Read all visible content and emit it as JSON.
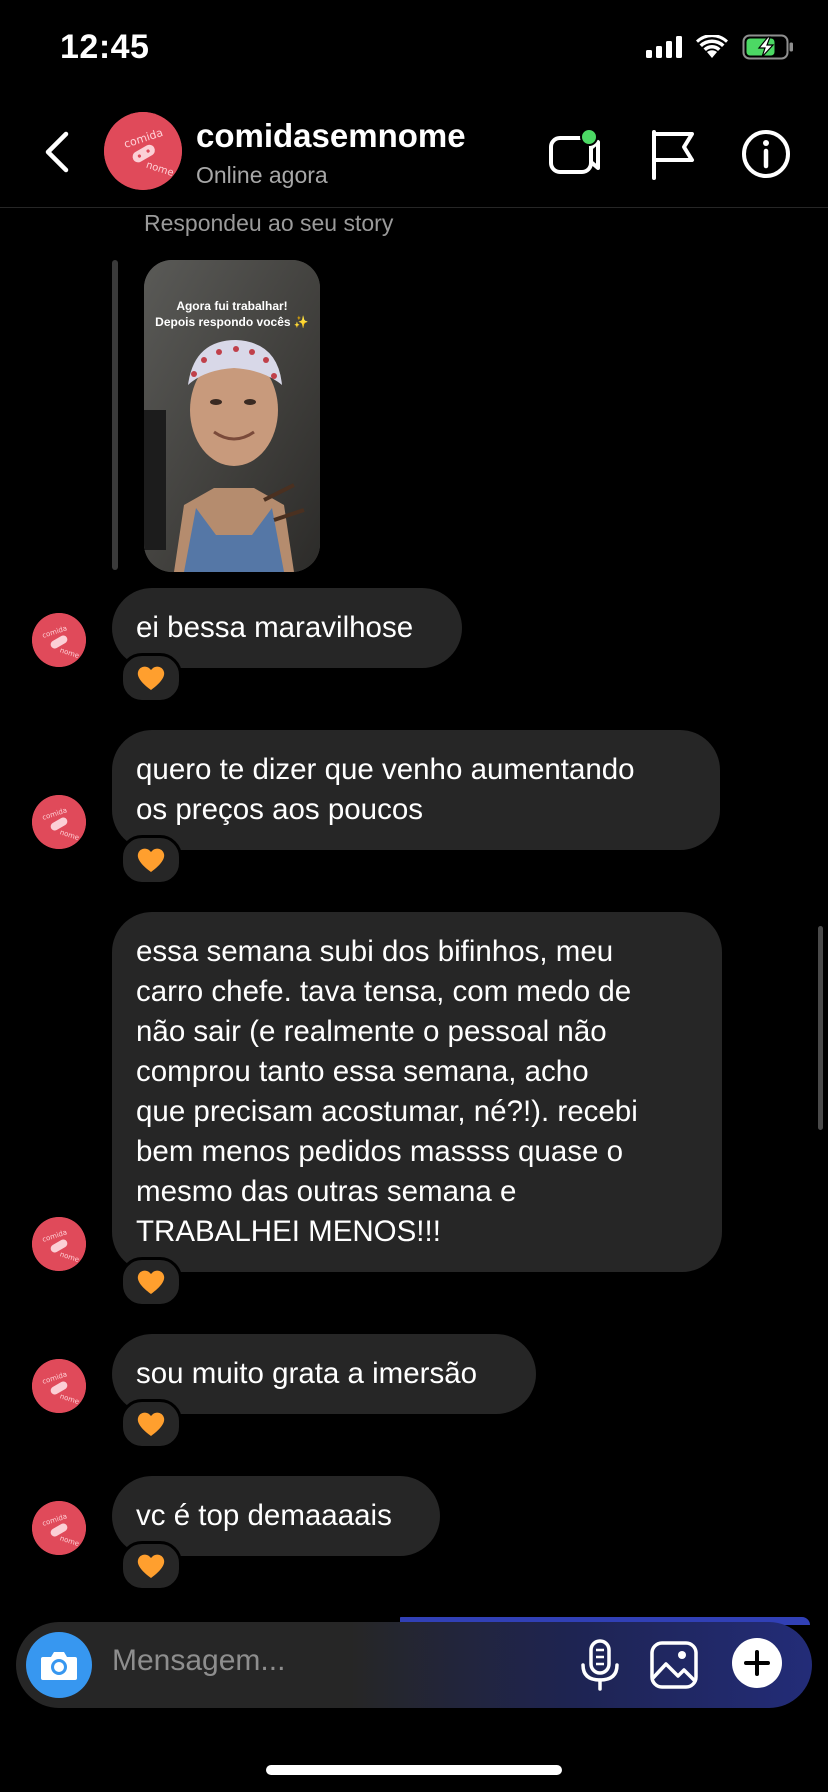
{
  "status_bar": {
    "time": "12:45"
  },
  "header": {
    "username": "comidasemnome",
    "presence": "Online agora",
    "avatar_text_top": "comida",
    "avatar_text_bottom": "nome"
  },
  "story_reply": {
    "caption": "Respondeu ao seu story",
    "story_text_line1": "Agora fui trabalhar!",
    "story_text_line2": "Depois respondo vocês ✨"
  },
  "messages": [
    {
      "text": "ei bessa maravilhose",
      "reaction": "🧡"
    },
    {
      "text": "quero te dizer que venho aumentando\nos preços aos poucos",
      "reaction": "🧡"
    },
    {
      "text": "essa semana subi dos bifinhos, meu\ncarro chefe. tava tensa, com medo de\nnão sair (e realmente o pessoal não\ncomprou tanto essa semana, acho\nque precisam acostumar, né?!). recebi\nbem menos pedidos massss quase o\nmesmo das outras semana e\nTRABALHEI MENOS!!!",
      "reaction": "🧡"
    },
    {
      "text": "sou muito grata a imersão",
      "reaction": "🧡"
    },
    {
      "text": "vc é top demaaaais",
      "reaction": "🧡"
    }
  ],
  "composer": {
    "placeholder": "Mensagem..."
  },
  "colors": {
    "bubble": "#262626",
    "avatar": "#e04a5a",
    "online_dot": "#4cd964",
    "camera": "#3797f0",
    "battery": "#4cd964"
  }
}
